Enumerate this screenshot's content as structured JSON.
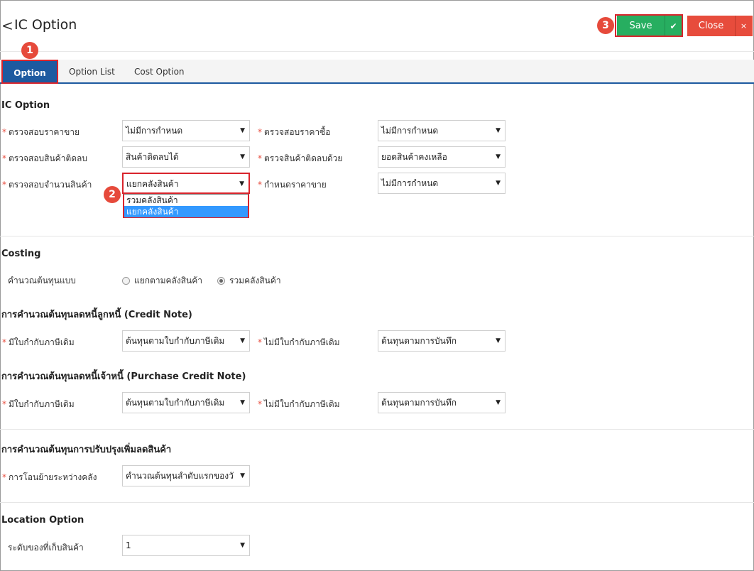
{
  "header": {
    "back_glyph": "<",
    "title": "IC Option",
    "save_label": "Save",
    "close_label": "Close"
  },
  "tabs": [
    {
      "label": "Option",
      "active": true
    },
    {
      "label": "Option List",
      "active": false
    },
    {
      "label": "Cost Option",
      "active": false
    }
  ],
  "badges": [
    "1",
    "2",
    "3"
  ],
  "ic_option": {
    "title": "IC Option",
    "fields": [
      {
        "label": "ตรวจสอบราคาขาย",
        "value": "ไม่มีการกำหนด"
      },
      {
        "label": "ตรวจสอบราคาซื้อ",
        "value": "ไม่มีการกำหนด"
      },
      {
        "label": "ตรวจสอบสินค้าติดลบ",
        "value": "สินค้าติดลบได้"
      },
      {
        "label": "ตรวจสินค้าติดลบด้วย",
        "value": "ยอดสินค้าคงเหลือ"
      },
      {
        "label": "ตรวจสอบจำนวนสินค้า",
        "value": "แยกคลังสินค้า"
      },
      {
        "label": "กำหนดราคาขาย",
        "value": "ไม่มีการกำหนด"
      }
    ],
    "dropdown_options": [
      "รวมคลังสินค้า",
      "แยกคลังสินค้า"
    ]
  },
  "costing": {
    "title": "Costing",
    "label": "คำนวณต้นทุนแบบ",
    "options": [
      "แยกตามคลังสินค้า",
      "รวมคลังสินค้า"
    ],
    "selected": "รวมคลังสินค้า"
  },
  "credit_note": {
    "title": "การคำนวณต้นทุนลดหนี้ลูกหนี้ (Credit Note)",
    "fields": [
      {
        "label": "มีใบกำกับภาษีเดิม",
        "value": "ต้นทุนตามใบกำกับภาษีเดิม"
      },
      {
        "label": "ไม่มีใบกำกับภาษีเดิม",
        "value": "ต้นทุนตามการบันทึก"
      }
    ]
  },
  "purchase_credit_note": {
    "title": "การคำนวณต้นทุนลดหนี้เจ้าหนี้ (Purchase Credit Note)",
    "fields": [
      {
        "label": "มีใบกำกับภาษีเดิม",
        "value": "ต้นทุนตามใบกำกับภาษีเดิม"
      },
      {
        "label": "ไม่มีใบกำกับภาษีเดิม",
        "value": "ต้นทุนตามการบันทึก"
      }
    ]
  },
  "adjust": {
    "title": "การคำนวณต้นทุนการปรับปรุงเพิ่มลดสินค้า",
    "fields": [
      {
        "label": "การโอนย้ายระหว่างคลัง",
        "value": "คำนวณต้นทุนลำดับแรกของวั"
      }
    ]
  },
  "location": {
    "title": "Location Option",
    "fields": [
      {
        "label": "ระดับของที่เก็บสินค้า",
        "value": "1"
      }
    ]
  },
  "ui": {
    "required_mark": "*",
    "arrow_glyph": "▼",
    "check_glyph": "✔",
    "close_glyph": "×"
  },
  "colors": {
    "save": "#27ae60",
    "close": "#e74c3c",
    "tab_active": "#1d5aa0",
    "highlight": "#d9242c",
    "badge": "#e64a3b",
    "dropdown_selected": "#3399ff"
  }
}
